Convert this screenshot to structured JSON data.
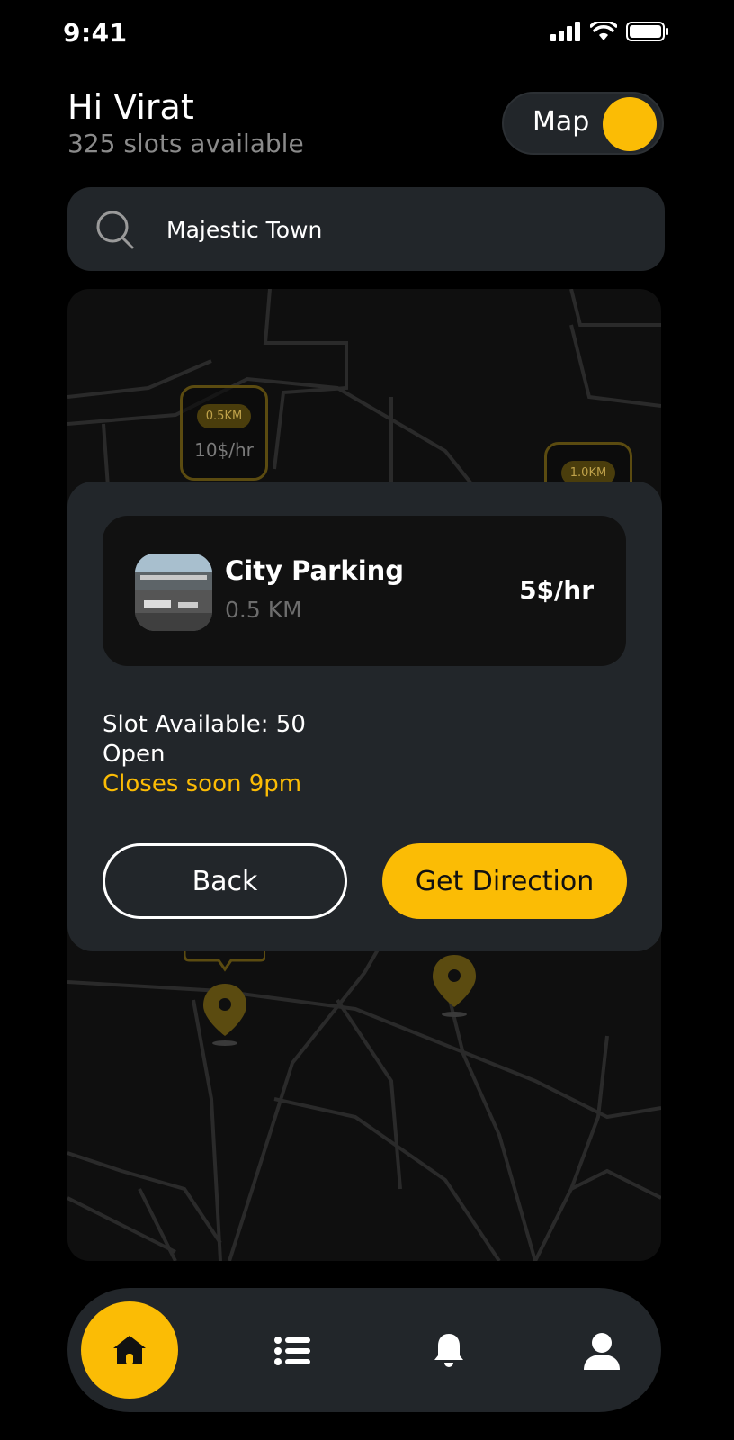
{
  "status_bar": {
    "time": "9:41"
  },
  "header": {
    "greeting": "Hi Virat",
    "subtitle": "325 slots available",
    "map_toggle_label": "Map"
  },
  "search": {
    "value": "Majestic Town"
  },
  "map": {
    "markers": [
      {
        "distance": "0.5KM",
        "price": "10$/hr"
      },
      {
        "distance": "1.0KM"
      }
    ]
  },
  "detail": {
    "name": "City Parking",
    "distance": "0.5 KM",
    "price": "5$/hr",
    "slots": "Slot Available: 50",
    "status": "Open",
    "closing": "Closes soon 9pm",
    "back_label": "Back",
    "direction_label": "Get Direction"
  },
  "nav": {
    "items": [
      "home-icon",
      "list-icon",
      "bell-icon",
      "user-icon"
    ],
    "active": "home"
  },
  "colors": {
    "accent": "#fbbc05",
    "card": "#22262a",
    "background": "#000000"
  }
}
